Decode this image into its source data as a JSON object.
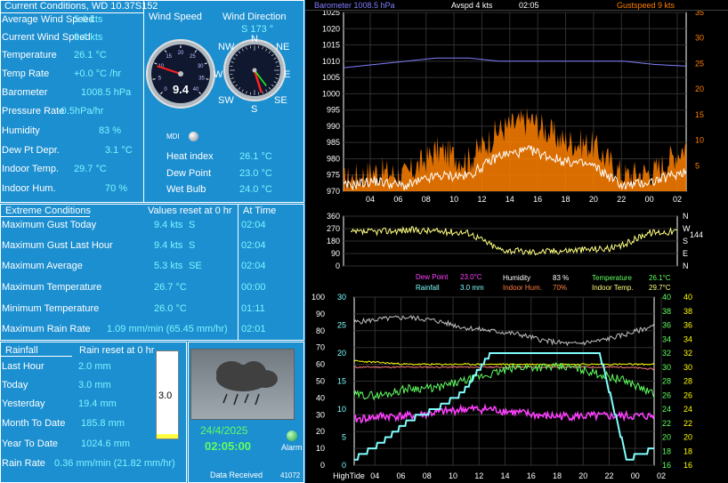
{
  "current": {
    "title": "Current Conditions, WD 10.37S152",
    "rows": [
      {
        "label": "Average Wind Speed",
        "value": "5.0 kts"
      },
      {
        "label": "Current Wind Speed",
        "value": "9.4 kts"
      },
      {
        "label": "Temperature",
        "value": "26.1 °C"
      },
      {
        "label": "Temp Rate",
        "value": "+0.0 °C /hr"
      },
      {
        "label": "Barometer",
        "value": "1008.5 hPa"
      },
      {
        "label": "Pressure Rate",
        "value": "-0.5hPa/hr"
      },
      {
        "label": "Humidity",
        "value": "83 %"
      },
      {
        "label": "Dew Pt Depr.",
        "value": "3.1 °C"
      },
      {
        "label": "Indoor Temp.",
        "value": "29.7 °C"
      },
      {
        "label": "Indoor Hum.",
        "value": "70 %"
      }
    ],
    "wind_speed_title": "Wind Speed",
    "wind_dir_title": "Wind Direction",
    "wind_dir_value": "S  173 °",
    "wind_gauge_value": "9.4",
    "mdi_label": "MDI",
    "extra": [
      {
        "label": "Heat index",
        "value": "26.1 °C"
      },
      {
        "label": "Dew Point",
        "value": "23.0 °C"
      },
      {
        "label": "Wet Bulb",
        "value": "24.0 °C"
      }
    ]
  },
  "speed_gauge": {
    "ticks": [
      "0",
      "5",
      "10",
      "15",
      "20",
      "25",
      "30",
      "35",
      "40"
    ],
    "needle": 9.4
  },
  "compass": {
    "N": "N",
    "NE": "NE",
    "E": "E",
    "SE": "SE",
    "S": "S",
    "SW": "SW",
    "W": "W",
    "NW": "NW",
    "direction": 173
  },
  "extremes": {
    "title": "Extreme Conditions",
    "reset": "Values reset at 0 hr",
    "at_time": "At Time",
    "rows": [
      {
        "label": "Maximum Gust Today",
        "value": "9.4 kts",
        "dir": "S",
        "time": "02:04"
      },
      {
        "label": "Maximum Gust Last Hour",
        "value": "9.4 kts",
        "dir": "S",
        "time": "02:04"
      },
      {
        "label": "Maximum Average",
        "value": "5.3 kts",
        "dir": "SE",
        "time": "02:04"
      },
      {
        "label": "Maximum Temperature",
        "value": "26.7 °C",
        "dir": "",
        "time": "00:00"
      },
      {
        "label": "Minimum Temperature",
        "value": "26.0 °C",
        "dir": "",
        "time": "01:11"
      },
      {
        "label": "Maximum Rain Rate",
        "value": "1.09 mm/min (65.45 mm/hr)",
        "dir": "",
        "time": "02:01"
      }
    ]
  },
  "rainfall": {
    "title": "Rainfall",
    "reset": "Rain reset at 0 hr",
    "rows": [
      {
        "label": "Last Hour",
        "value": "2.0 mm"
      },
      {
        "label": "Today",
        "value": "3.0 mm"
      },
      {
        "label": "Yesterday",
        "value": "19.4 mm"
      },
      {
        "label": "Month To Date",
        "value": "185.8 mm"
      },
      {
        "label": "Year To Date",
        "value": "1024.6 mm"
      }
    ],
    "rate_label": "Rain Rate",
    "rate_value": "0.36 mm/min (21.82 mm/hr)",
    "gauge_value": "3.0"
  },
  "status": {
    "date": "24/4/2025",
    "time": "02:05:00",
    "alarm": "Alarm",
    "received": "Data Received",
    "count": "41072"
  },
  "graph1": {
    "barometer": "Barometer 1008.5 hPa",
    "avspd": "Avspd  4 kts",
    "time": "02:05",
    "gust": "Gustspeed  9 kts"
  },
  "graph3_legend": {
    "dew": "Dew Point",
    "dew_val": "23.0°C",
    "hum": "Humidity",
    "hum_val": "83 %",
    "temp": "Temperature",
    "temp_val": "26.1°C",
    "rain": "Rainfall",
    "rain_val": "3.0 mm",
    "ihum": "Indoor Hum.",
    "ihum_val": "70%",
    "itemp": "Indoor Temp.",
    "itemp_val": "29.7°C"
  },
  "colors": {
    "panel": "#1c8fd0",
    "value": "#7ff3ff",
    "gust": "#ff8000",
    "baro": "#8080ff",
    "dirline": "#ffff80"
  },
  "chart_data": [
    {
      "type": "line",
      "title": "",
      "x": [
        "04",
        "06",
        "08",
        "10",
        "12",
        "14",
        "16",
        "18",
        "20",
        "22",
        "00",
        "02"
      ],
      "y_left": {
        "label": "Barometer",
        "ylim": [
          970,
          1025
        ],
        "ticks": [
          "970",
          "975",
          "980",
          "985",
          "990",
          "995",
          "1000",
          "1005",
          "1010",
          "1015",
          "1020",
          "1025"
        ]
      },
      "y_right": {
        "label": "Gustspeed",
        "ylim": [
          0,
          35
        ],
        "ticks": [
          "5",
          "10",
          "15",
          "20",
          "25",
          "30",
          "35"
        ]
      },
      "series": [
        {
          "name": "Barometer",
          "color": "#8080ff",
          "values": [
            1008,
            1009,
            1010,
            1011,
            1011,
            1010,
            1010,
            1010,
            1010,
            1010,
            1009,
            1008.5
          ]
        },
        {
          "name": "Gustspeed",
          "color": "#ff8000",
          "values": [
            2,
            4,
            3,
            8,
            6,
            12,
            14,
            10,
            9,
            3,
            4,
            9
          ]
        },
        {
          "name": "Avspd",
          "color": "#ffffff",
          "values": [
            1,
            2,
            1,
            3,
            3,
            7,
            8,
            6,
            5,
            1,
            2,
            4
          ]
        }
      ]
    },
    {
      "type": "line",
      "title": "",
      "y_left": {
        "ylim": [
          0,
          360
        ],
        "ticks": [
          "360",
          "270",
          "180",
          "90",
          "0"
        ]
      },
      "y_right_labels": [
        "N",
        "W",
        "S",
        "E",
        "N"
      ],
      "y_right_extra": "144",
      "series": [
        {
          "name": "Wind Direction",
          "color": "#ffff80",
          "values": [
            240,
            250,
            260,
            250,
            240,
            120,
            100,
            110,
            120,
            130,
            240,
            250
          ]
        }
      ]
    },
    {
      "type": "line",
      "title": "",
      "x": [
        "HighTide",
        "04",
        "06",
        "08",
        "10",
        "12",
        "14",
        "16",
        "18",
        "20",
        "22",
        "00",
        "02"
      ],
      "y_left_outer": {
        "ylim": [
          0,
          100
        ],
        "ticks": [
          "0",
          "10",
          "20",
          "30",
          "40",
          "50",
          "60",
          "70",
          "80",
          "90",
          "100"
        ]
      },
      "y_left_inner": {
        "ylim": [
          0,
          30
        ],
        "ticks": [
          "0",
          "5",
          "10",
          "15",
          "20",
          "25",
          "30"
        ]
      },
      "y_right_1": {
        "ylim": [
          16,
          40
        ],
        "ticks": [
          "16",
          "18",
          "20",
          "22",
          "24",
          "26",
          "28",
          "30",
          "32",
          "34",
          "36",
          "38",
          "40"
        ]
      },
      "y_right_2": {
        "ylim": [
          16,
          40
        ],
        "ticks": [
          "16",
          "18",
          "20",
          "22",
          "24",
          "26",
          "28",
          "30",
          "32",
          "34",
          "36",
          "38",
          "40"
        ]
      },
      "series": [
        {
          "name": "Humidity",
          "color": "#c0c0c0",
          "values": [
            85,
            87,
            88,
            86,
            82,
            80,
            78,
            74,
            72,
            74,
            78,
            83
          ]
        },
        {
          "name": "Indoor Temp.",
          "color": "#ff8080",
          "values": [
            30,
            30,
            30,
            30,
            30,
            30,
            30,
            30,
            30,
            30,
            30,
            29.7
          ]
        },
        {
          "name": "Indoor Hum.",
          "color": "#ffff00",
          "values": [
            62,
            61,
            60,
            60,
            60,
            60,
            60,
            60,
            60,
            60,
            60,
            60
          ]
        },
        {
          "name": "Temperature",
          "color": "#60ff60",
          "values": [
            26,
            26,
            27,
            27,
            28,
            29,
            30,
            30,
            30,
            29,
            28,
            26.1
          ]
        },
        {
          "name": "Dew Point",
          "color": "#ff40ff",
          "values": [
            22.5,
            23,
            23,
            23.5,
            24,
            24,
            23.5,
            23,
            23,
            23,
            23,
            23
          ]
        },
        {
          "name": "Rainfall",
          "color": "#80ffff",
          "values": [
            1,
            4,
            8,
            10,
            13,
            20,
            20,
            20,
            20,
            20,
            1,
            3
          ]
        }
      ]
    }
  ]
}
